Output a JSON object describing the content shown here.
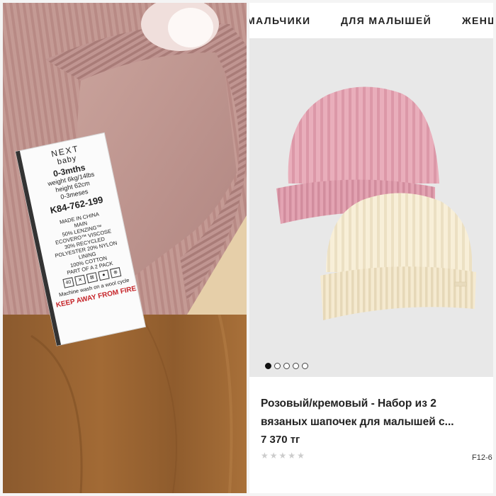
{
  "label": {
    "brand": "NEXT",
    "brand_sub": "baby",
    "size": "0-3mths",
    "weight_line": "weight 6kg/14lbs",
    "height_line": "height 62cm",
    "meses": "0-3meses",
    "code": "K84-762-199",
    "made_in": "MADE IN CHINA",
    "main": "MAIN",
    "comp1": "50% LENZING™",
    "comp2": "ECOVERO™ VISCOSE",
    "comp3": "30% RECYCLED",
    "comp4": "POLYESTER 20% NYLON",
    "lining": "LINING",
    "comp5": "100% COTTON",
    "pack": "PART OF A 2 PACK",
    "wash_temp": "40",
    "wash_note": "Machine wash on a wool cycle",
    "fire": "KEEP AWAY FROM FIRE"
  },
  "nav": {
    "items": [
      {
        "label": "МАЛЬЧИКИ"
      },
      {
        "label": "ДЛЯ МАЛЫШЕЙ"
      },
      {
        "label": "ЖЕНЩ"
      }
    ]
  },
  "carousel": {
    "total": 5,
    "active_index": 0
  },
  "product": {
    "title_line1": "Розовый/кремовый - Набор из 2",
    "title_line2": "вязаных шапочек для малышей с...",
    "price": "7 370 тг",
    "rating": 0,
    "sku": "F12-6"
  },
  "colors": {
    "pink_hat": "#e7a9b7",
    "cream_hat": "#f6ecd3",
    "page_bg": "#e8e8e8",
    "fire_text": "#c6252a"
  }
}
